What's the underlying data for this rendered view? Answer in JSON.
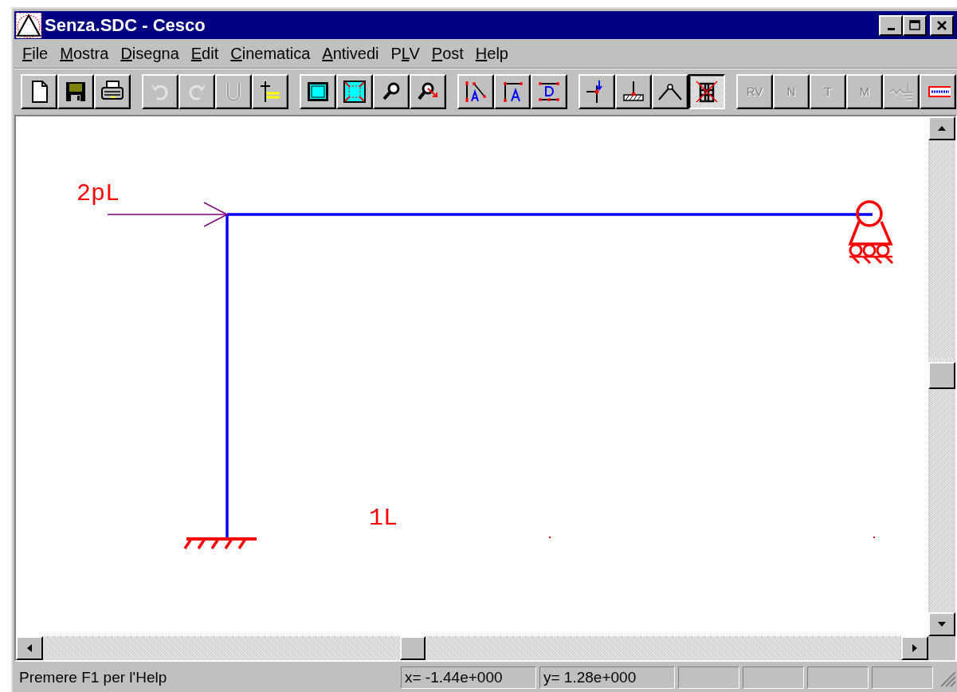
{
  "window": {
    "title": "Senza.SDC - Cesco"
  },
  "menu": [
    {
      "key": "F",
      "after": "ile"
    },
    {
      "key": "M",
      "after": "ostra"
    },
    {
      "key": "D",
      "after": "isegna"
    },
    {
      "key": "E",
      "after": "dit"
    },
    {
      "key": "C",
      "after": "inematica"
    },
    {
      "key": "A",
      "after": "ntivedi"
    },
    {
      "before": "P",
      "key": "L",
      "after": "V"
    },
    {
      "key": "P",
      "after": "ost"
    },
    {
      "key": "H",
      "after": "elp"
    }
  ],
  "toolbar": [
    [
      {
        "kind": "new",
        "disabled": false,
        "pressed": false
      },
      {
        "kind": "save",
        "disabled": false,
        "pressed": false
      },
      {
        "kind": "print",
        "disabled": false,
        "pressed": false
      }
    ],
    [
      {
        "kind": "undo",
        "disabled": true,
        "pressed": false
      },
      {
        "kind": "redo",
        "disabled": true,
        "pressed": false
      },
      {
        "kind": "hook",
        "disabled": true,
        "pressed": false
      },
      {
        "kind": "plusline",
        "disabled": false,
        "pressed": false
      }
    ],
    [
      {
        "kind": "frame",
        "disabled": false,
        "pressed": false
      },
      {
        "kind": "frameall",
        "disabled": false,
        "pressed": false
      },
      {
        "kind": "zoom",
        "disabled": false,
        "pressed": false
      },
      {
        "kind": "zoomout",
        "disabled": false,
        "pressed": false
      }
    ],
    [
      {
        "kind": "dimslope",
        "disabled": false,
        "pressed": false
      },
      {
        "kind": "dimcorner",
        "disabled": false,
        "pressed": false
      },
      {
        "kind": "dimbox",
        "disabled": false,
        "pressed": false
      }
    ],
    [
      {
        "kind": "joint",
        "disabled": false,
        "pressed": false
      },
      {
        "kind": "ground",
        "disabled": false,
        "pressed": false
      },
      {
        "kind": "hinge",
        "disabled": false,
        "pressed": false
      },
      {
        "kind": "grid",
        "disabled": false,
        "pressed": true
      }
    ],
    [
      {
        "kind": "text",
        "label": "RV",
        "disabled": true,
        "pressed": false
      },
      {
        "kind": "text",
        "label": "N",
        "disabled": true,
        "pressed": false
      },
      {
        "kind": "text",
        "label": "T",
        "disabled": true,
        "pressed": false
      },
      {
        "kind": "text",
        "label": "M",
        "disabled": true,
        "pressed": false
      },
      {
        "kind": "spring",
        "disabled": true,
        "pressed": false
      },
      {
        "kind": "ruler",
        "disabled": false,
        "pressed": false
      }
    ]
  ],
  "drawing": {
    "load_label": "2pL",
    "length_label": "1L"
  },
  "status_bar": {
    "message": "Premere F1 per l'Help",
    "x": "x= -1.44e+000",
    "y": "y= 1.28e+000"
  }
}
